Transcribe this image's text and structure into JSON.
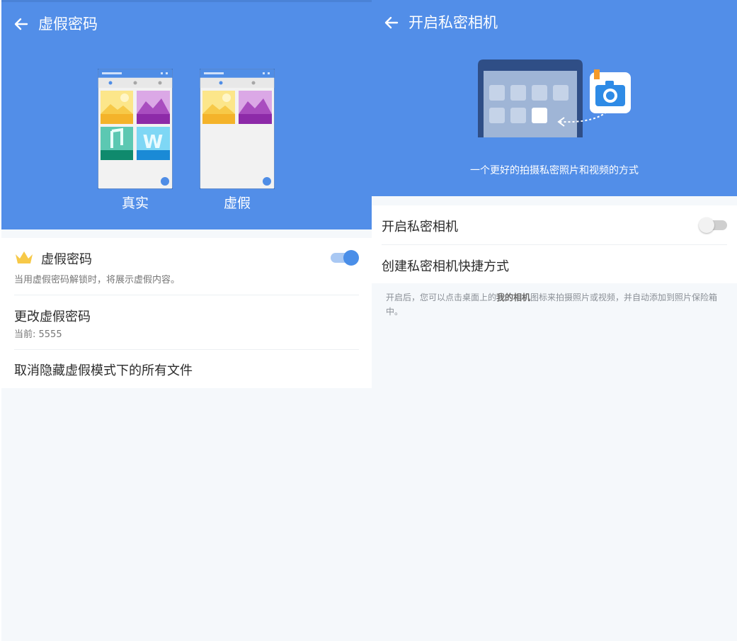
{
  "left_screen": {
    "title": "虚假密码",
    "illustration": {
      "real_label": "真实",
      "fake_label": "虚假"
    },
    "fake_password_row": {
      "title": "虚假密码",
      "subtitle": "当用虚假密码解锁时，将展示虚假内容。",
      "toggle_on": true,
      "icon": "crown-icon"
    },
    "change_password_row": {
      "title": "更改虚假密码",
      "subtitle": "当前: 5555"
    },
    "unhide_row": {
      "title": "取消隐藏虚假模式下的所有文件"
    }
  },
  "right_screen": {
    "title": "开启私密相机",
    "slogan": "一个更好的拍摄私密照片和视频的方式",
    "enable_row": {
      "title": "开启私密相机",
      "toggle_on": false
    },
    "shortcut_row": {
      "title": "创建私密相机快捷方式"
    },
    "note": {
      "before": "开启后，您可以点击桌面上的",
      "highlight": "我的相机",
      "after": "图标来拍摄照片或视频，并自动添加到照片保险箱中。"
    }
  },
  "colors": {
    "primary": "#528ee8",
    "toggle_on": "#4a8ee8",
    "toggle_off": "#d0d0d0"
  }
}
